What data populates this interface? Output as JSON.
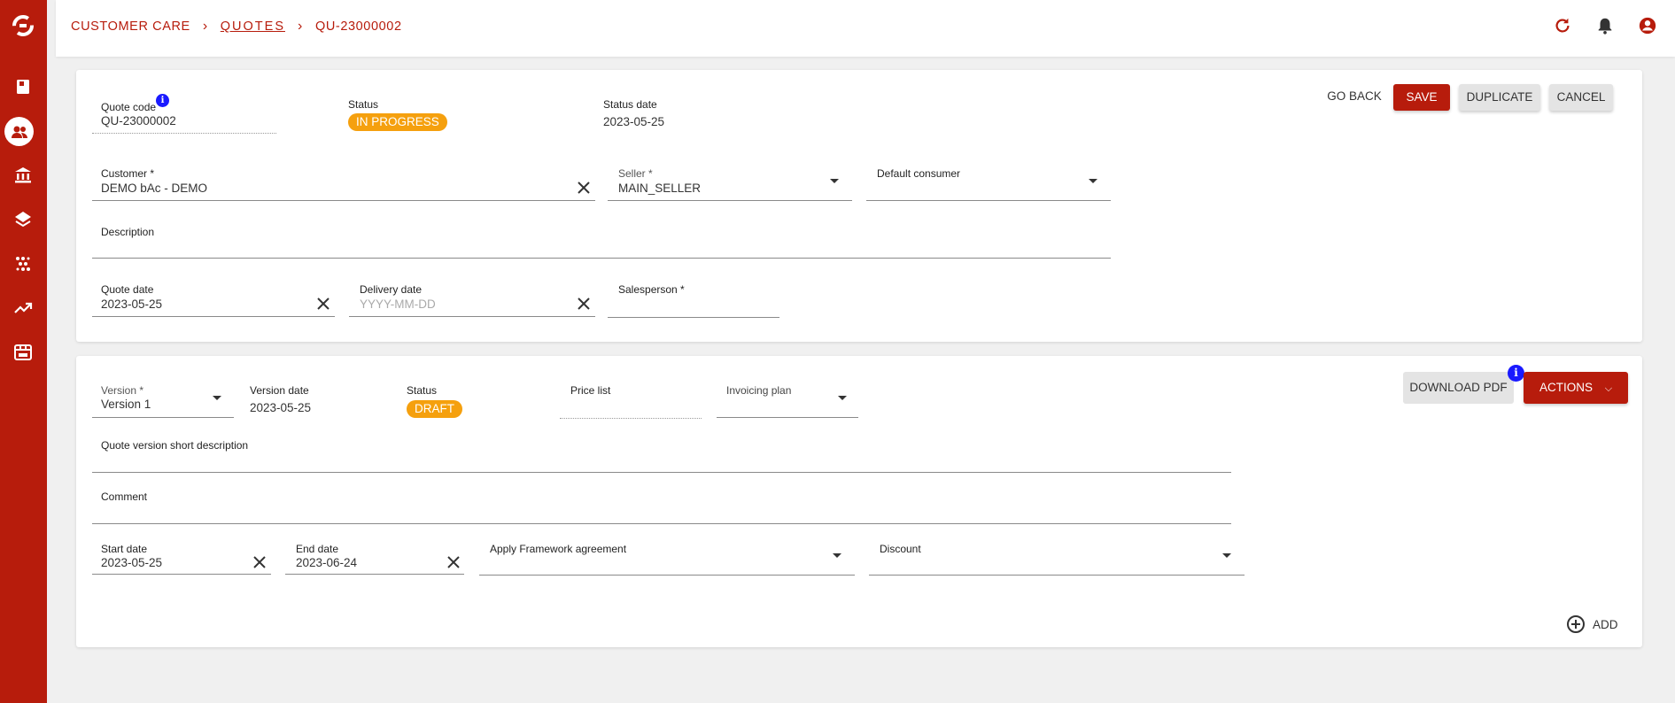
{
  "breadcrumb": {
    "root": "CUSTOMER CARE",
    "section": "QUOTES",
    "current": "QU-23000002"
  },
  "header_actions": {
    "go_back": "GO BACK",
    "save": "SAVE",
    "duplicate": "DUPLICATE",
    "cancel": "CANCEL"
  },
  "quote": {
    "code_label": "Quote code",
    "code_value": "QU-23000002",
    "status_label": "Status",
    "status_value": "IN PROGRESS",
    "status_date_label": "Status date",
    "status_date_value": "2023-05-25",
    "customer_label": "Customer *",
    "customer_value": "DEMO bAc - DEMO",
    "seller_label": "Seller *",
    "seller_value": "MAIN_SELLER",
    "consumer_label": "Default consumer",
    "consumer_value": "",
    "description_label": "Description",
    "quote_date_label": "Quote date",
    "quote_date_value": "2023-05-25",
    "delivery_date_label": "Delivery date",
    "delivery_date_placeholder": "YYYY-MM-DD",
    "salesperson_label": "Salesperson *"
  },
  "version": {
    "version_label": "Version *",
    "version_value": "Version 1",
    "version_date_label": "Version date",
    "version_date_value": "2023-05-25",
    "status_label": "Status",
    "status_value": "DRAFT",
    "price_list_label": "Price list",
    "invoicing_plan_label": "Invoicing plan",
    "short_desc_label": "Quote version short description",
    "comment_label": "Comment",
    "start_date_label": "Start date",
    "start_date_value": "2023-05-25",
    "end_date_label": "End date",
    "end_date_value": "2023-06-24",
    "framework_label": "Apply Framework agreement",
    "discount_label": "Discount",
    "download_pdf": "DOWNLOAD PDF",
    "actions": "ACTIONS",
    "add": "ADD"
  },
  "colors": {
    "brand": "#b71c0c",
    "badge": "#f5a00e",
    "info": "#1a1aff"
  }
}
